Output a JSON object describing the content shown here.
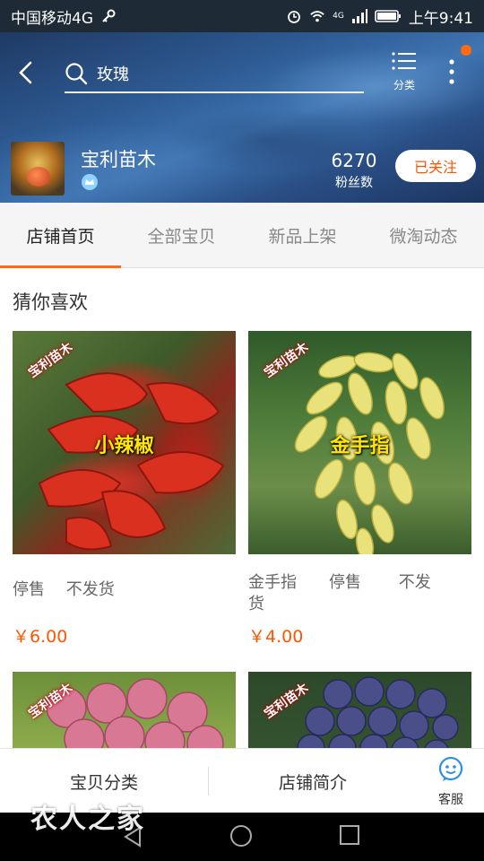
{
  "status_bar": {
    "carrier": "中国移动4G",
    "network": "4G",
    "time": "上午9:41"
  },
  "header": {
    "search_query": "玫瑰",
    "category_label": "分类",
    "shop_name": "宝利苗木",
    "fans_count": "6270",
    "fans_label": "粉丝数",
    "follow_label": "已关注"
  },
  "tabs": [
    {
      "label": "店铺首页",
      "active": true
    },
    {
      "label": "全部宝贝",
      "active": false
    },
    {
      "label": "新品上架",
      "active": false
    },
    {
      "label": "微淘动态",
      "active": false
    }
  ],
  "section": {
    "title": "猜你喜欢"
  },
  "products": [
    {
      "image_label": "小辣椒",
      "watermark": "宝利苗木",
      "description": "停售　 不发货",
      "price": "￥6.00"
    },
    {
      "image_label": "金手指",
      "watermark": "宝利苗木",
      "description_line1": "金手指　　停售　　 不发",
      "description_line2": "货",
      "price": "￥4.00"
    },
    {
      "image_label": "",
      "watermark": "宝利苗木"
    },
    {
      "image_label": "",
      "watermark": "宝利苗木"
    }
  ],
  "bottom_bar": {
    "category_label": "宝贝分类",
    "intro_label": "店铺简介",
    "service_label": "客服"
  },
  "watermark_brand": "农人之家",
  "colors": {
    "accent": "#ff6a13",
    "price": "#ff5500",
    "label_yellow": "#ffe600"
  }
}
